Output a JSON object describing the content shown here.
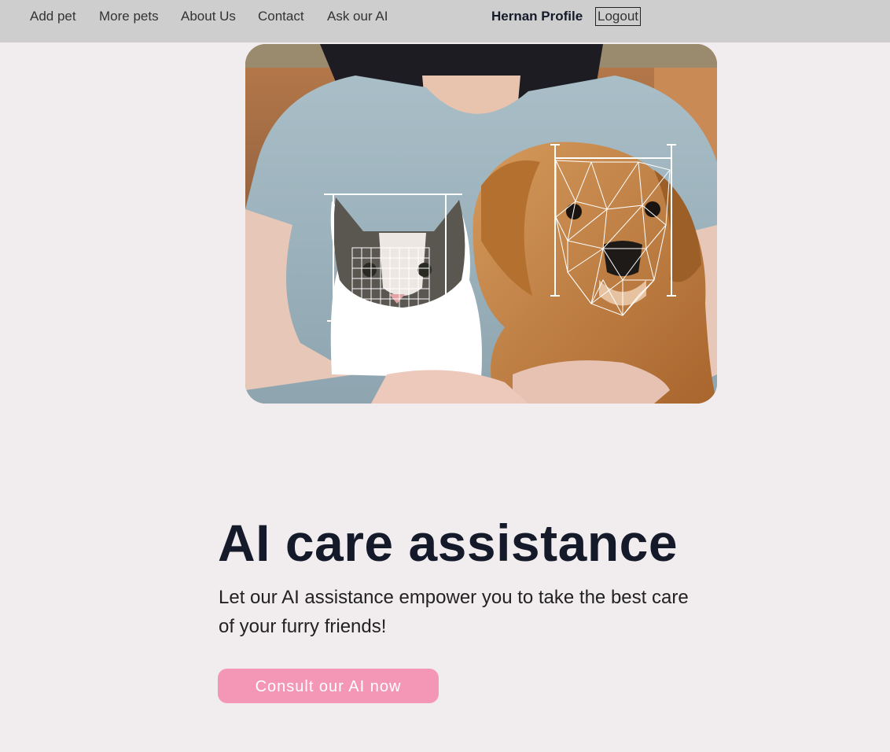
{
  "nav": {
    "links": [
      "Add pet",
      "More pets",
      "About Us",
      "Contact",
      "Ask our AI"
    ],
    "profile_label": "Hernan Profile",
    "logout_label": "Logout"
  },
  "hero": {
    "headline": "AI care assistance",
    "subtext": "Let our AI assistance empower you to take the best care of your furry friends!",
    "cta_label": "Consult our AI now"
  },
  "colors": {
    "background": "#f1eced",
    "navbar": "#cecece",
    "cta": "#f497b6",
    "heading": "#151a2a"
  }
}
